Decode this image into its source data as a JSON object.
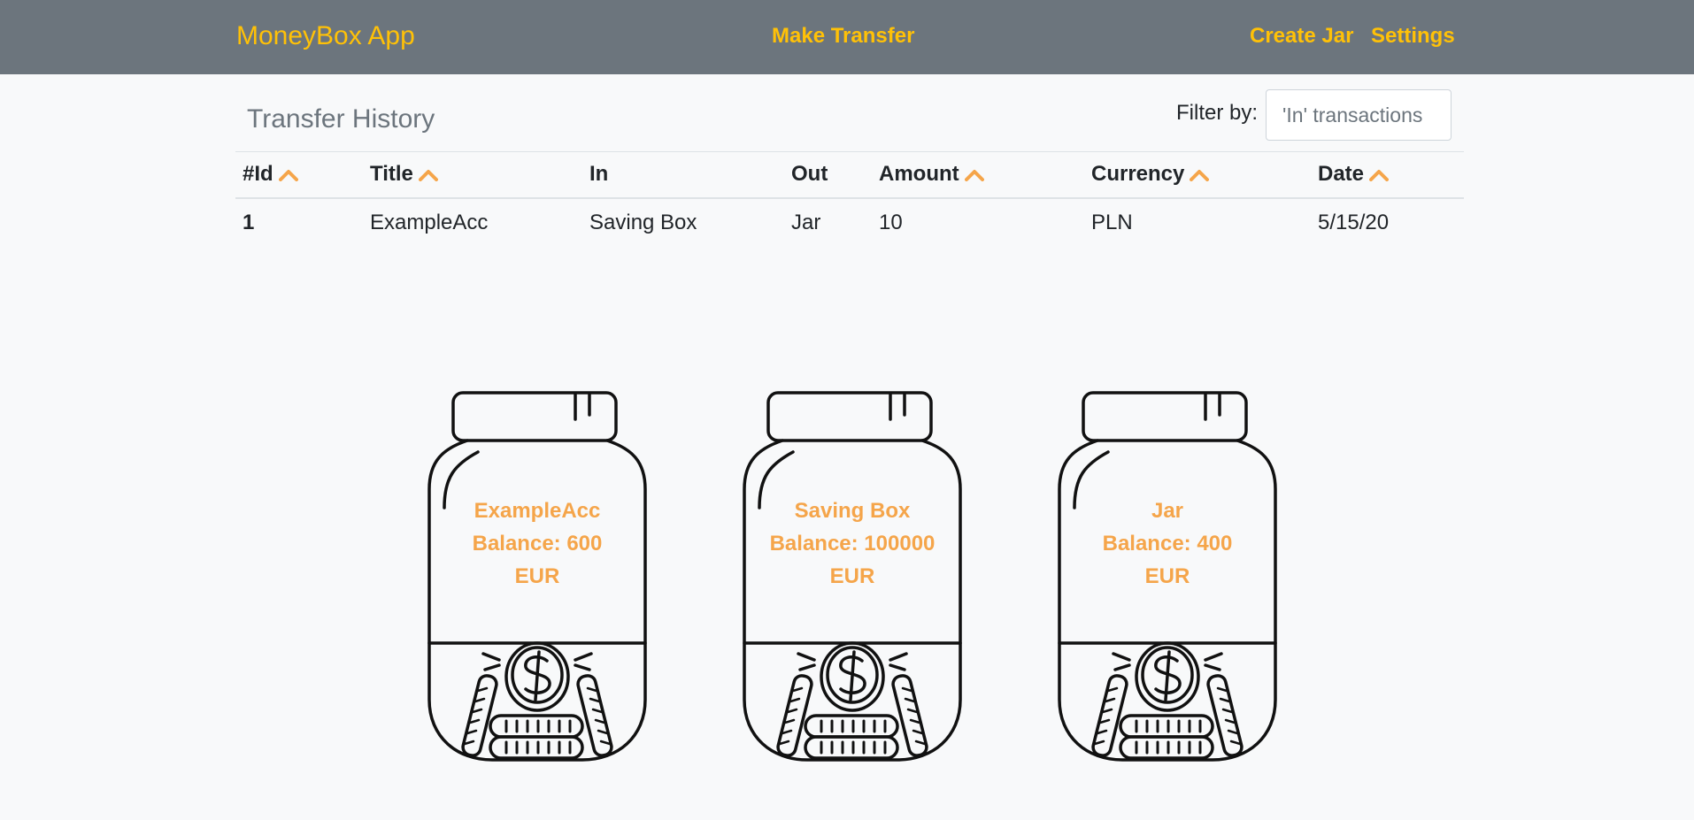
{
  "navbar": {
    "brand": "MoneyBox App",
    "make_transfer": "Make Transfer",
    "create_jar": "Create Jar",
    "settings": "Settings",
    "bg_color": "#6c757d",
    "accent_color": "#ffc107"
  },
  "history": {
    "title": "Transfer History",
    "filter_label": "Filter by:",
    "filter_placeholder": "'In' transactions",
    "columns": {
      "id": "#Id",
      "title": "Title",
      "in": "In",
      "out": "Out",
      "amount": "Amount",
      "currency": "Currency",
      "date": "Date"
    },
    "rows": [
      {
        "id": "1",
        "title": "ExampleAcc",
        "in": "Saving Box",
        "out": "Jar",
        "amount": "10",
        "currency": "PLN",
        "date": "5/15/20"
      }
    ]
  },
  "jars": [
    {
      "name": "ExampleAcc",
      "balance": "Balance: 600",
      "currency": "EUR"
    },
    {
      "name": "Saving Box",
      "balance": "Balance: 100000",
      "currency": "EUR"
    },
    {
      "name": "Jar",
      "balance": "Balance: 400",
      "currency": "EUR"
    }
  ],
  "icons": {
    "sort": "chevron-up-icon",
    "jar": "money-jar-icon"
  },
  "colors": {
    "sort_icon": "#f5a54a",
    "jar_text": "#f5a54a"
  }
}
